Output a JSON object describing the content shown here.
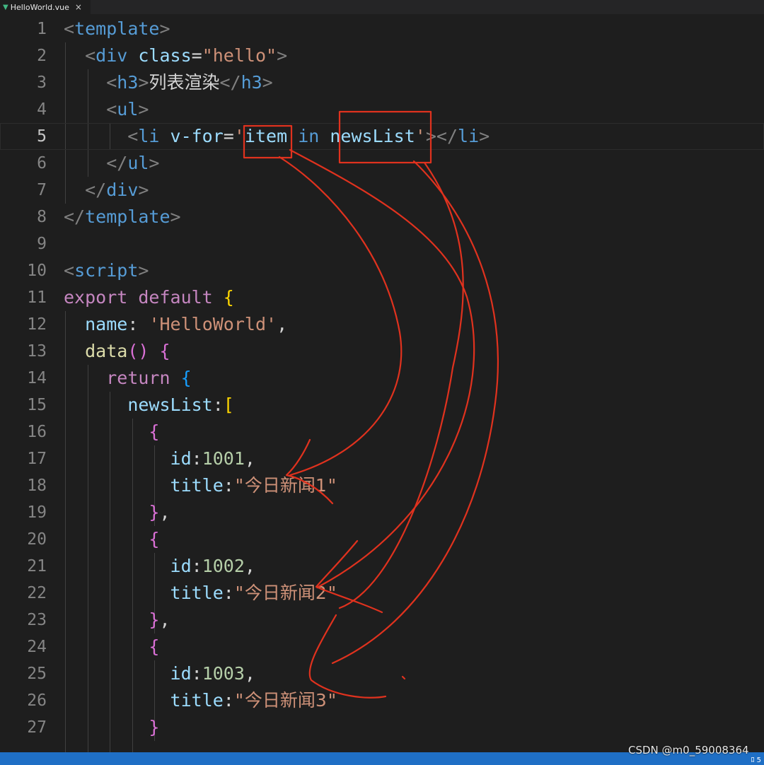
{
  "tab": {
    "filename": "HelloWorld.vue",
    "close_glyph": "×",
    "icon": "vue-file-icon"
  },
  "editor": {
    "current_line": 5,
    "lines": [
      {
        "n": "1",
        "tokens": [
          [
            "br",
            "<"
          ],
          [
            "tag",
            "template"
          ],
          [
            "br",
            ">"
          ]
        ]
      },
      {
        "n": "2",
        "tokens": [
          [
            "br",
            "  <"
          ],
          [
            "tag",
            "div"
          ],
          [
            "plain",
            " "
          ],
          [
            "attr",
            "class"
          ],
          [
            "plain",
            "="
          ],
          [
            "str",
            "\"hello\""
          ],
          [
            "br",
            ">"
          ]
        ]
      },
      {
        "n": "3",
        "tokens": [
          [
            "br",
            "    <"
          ],
          [
            "tag",
            "h3"
          ],
          [
            "br",
            ">"
          ],
          [
            "zh",
            "列表渲染"
          ],
          [
            "br",
            "</"
          ],
          [
            "tag",
            "h3"
          ],
          [
            "br",
            ">"
          ]
        ]
      },
      {
        "n": "4",
        "tokens": [
          [
            "br",
            "    <"
          ],
          [
            "tag",
            "ul"
          ],
          [
            "br",
            ">"
          ]
        ]
      },
      {
        "n": "5",
        "tokens": [
          [
            "br",
            "      <"
          ],
          [
            "tag",
            "li"
          ],
          [
            "plain",
            " "
          ],
          [
            "attr",
            "v-for"
          ],
          [
            "plain",
            "="
          ],
          [
            "str",
            "'"
          ],
          [
            "attr",
            "item"
          ],
          [
            "plain",
            " "
          ],
          [
            "tag",
            "in"
          ],
          [
            "plain",
            " "
          ],
          [
            "attr",
            "newsList"
          ],
          [
            "str",
            "'"
          ],
          [
            "br",
            "></"
          ],
          [
            "tag",
            "li"
          ],
          [
            "br",
            ">"
          ]
        ]
      },
      {
        "n": "6",
        "tokens": [
          [
            "br",
            "    </"
          ],
          [
            "tag",
            "ul"
          ],
          [
            "br",
            ">"
          ]
        ]
      },
      {
        "n": "7",
        "tokens": [
          [
            "br",
            "  </"
          ],
          [
            "tag",
            "div"
          ],
          [
            "br",
            ">"
          ]
        ]
      },
      {
        "n": "8",
        "tokens": [
          [
            "br",
            "</"
          ],
          [
            "tag",
            "template"
          ],
          [
            "br",
            ">"
          ]
        ]
      },
      {
        "n": "9",
        "tokens": []
      },
      {
        "n": "10",
        "tokens": [
          [
            "br",
            "<"
          ],
          [
            "tag",
            "script"
          ],
          [
            "br",
            ">"
          ]
        ]
      },
      {
        "n": "11",
        "tokens": [
          [
            "ctl",
            "export"
          ],
          [
            "plain",
            " "
          ],
          [
            "ctl",
            "default"
          ],
          [
            "plain",
            " "
          ],
          [
            "b1",
            "{"
          ]
        ]
      },
      {
        "n": "12",
        "tokens": [
          [
            "plain",
            "  "
          ],
          [
            "attr",
            "name"
          ],
          [
            "plain",
            ": "
          ],
          [
            "str",
            "'HelloWorld'"
          ],
          [
            "plain",
            ","
          ]
        ]
      },
      {
        "n": "13",
        "tokens": [
          [
            "plain",
            "  "
          ],
          [
            "fn",
            "data"
          ],
          [
            "b2",
            "()"
          ],
          [
            "plain",
            " "
          ],
          [
            "b2",
            "{"
          ]
        ]
      },
      {
        "n": "14",
        "tokens": [
          [
            "plain",
            "    "
          ],
          [
            "ctl",
            "return"
          ],
          [
            "plain",
            " "
          ],
          [
            "b3",
            "{"
          ]
        ]
      },
      {
        "n": "15",
        "tokens": [
          [
            "plain",
            "      "
          ],
          [
            "attr",
            "newsList"
          ],
          [
            "plain",
            ":"
          ],
          [
            "b1",
            "["
          ]
        ]
      },
      {
        "n": "16",
        "tokens": [
          [
            "plain",
            "        "
          ],
          [
            "b2",
            "{"
          ]
        ]
      },
      {
        "n": "17",
        "tokens": [
          [
            "plain",
            "          "
          ],
          [
            "attr",
            "id"
          ],
          [
            "plain",
            ":"
          ],
          [
            "num",
            "1001"
          ],
          [
            "plain",
            ","
          ]
        ]
      },
      {
        "n": "18",
        "tokens": [
          [
            "plain",
            "          "
          ],
          [
            "attr",
            "title"
          ],
          [
            "plain",
            ":"
          ],
          [
            "str",
            "\""
          ],
          [
            "zhs",
            "今日新闻1"
          ],
          [
            "str",
            "\""
          ]
        ]
      },
      {
        "n": "19",
        "tokens": [
          [
            "plain",
            "        "
          ],
          [
            "b2",
            "}"
          ],
          [
            "plain",
            ","
          ]
        ]
      },
      {
        "n": "20",
        "tokens": [
          [
            "plain",
            "        "
          ],
          [
            "b2",
            "{"
          ]
        ]
      },
      {
        "n": "21",
        "tokens": [
          [
            "plain",
            "          "
          ],
          [
            "attr",
            "id"
          ],
          [
            "plain",
            ":"
          ],
          [
            "num",
            "1002"
          ],
          [
            "plain",
            ","
          ]
        ]
      },
      {
        "n": "22",
        "tokens": [
          [
            "plain",
            "          "
          ],
          [
            "attr",
            "title"
          ],
          [
            "plain",
            ":"
          ],
          [
            "str",
            "\""
          ],
          [
            "zhs",
            "今日新闻2"
          ],
          [
            "str",
            "\""
          ]
        ]
      },
      {
        "n": "23",
        "tokens": [
          [
            "plain",
            "        "
          ],
          [
            "b2",
            "}"
          ],
          [
            "plain",
            ","
          ]
        ]
      },
      {
        "n": "24",
        "tokens": [
          [
            "plain",
            "        "
          ],
          [
            "b2",
            "{"
          ]
        ]
      },
      {
        "n": "25",
        "tokens": [
          [
            "plain",
            "          "
          ],
          [
            "attr",
            "id"
          ],
          [
            "plain",
            ":"
          ],
          [
            "num",
            "1003"
          ],
          [
            "plain",
            ","
          ]
        ]
      },
      {
        "n": "26",
        "tokens": [
          [
            "plain",
            "          "
          ],
          [
            "attr",
            "title"
          ],
          [
            "plain",
            ":"
          ],
          [
            "str",
            "\""
          ],
          [
            "zhs",
            "今日新闻3"
          ],
          [
            "str",
            "\""
          ]
        ]
      },
      {
        "n": "27",
        "tokens": [
          [
            "plain",
            "        "
          ],
          [
            "b2",
            "}"
          ]
        ]
      }
    ]
  },
  "annotation": {
    "color": "#e0321e"
  },
  "colors": {
    "background": "#1e1e1e",
    "line_number": "#858585",
    "tag": "#569cd6",
    "attribute": "#9cdcfe",
    "string": "#ce9178",
    "keyword": "#c586c0",
    "function": "#dcdcaa",
    "number": "#b5cea8",
    "status_bar": "#1f6fc5"
  },
  "status": {
    "right_text": "ﾛ 5"
  },
  "watermark": "CSDN @m0_59008364"
}
